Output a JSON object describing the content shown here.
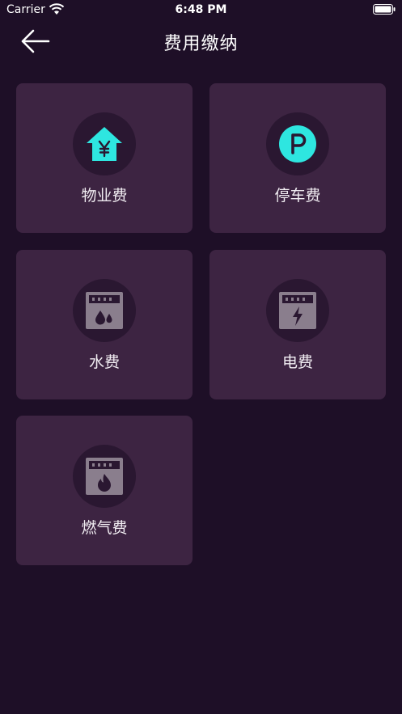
{
  "status": {
    "carrier": "Carrier",
    "time": "6:48 PM"
  },
  "nav": {
    "title": "费用缴纳"
  },
  "cards": [
    {
      "label": "物业费",
      "icon": "property-house-yen-icon"
    },
    {
      "label": "停车费",
      "icon": "parking-p-icon"
    },
    {
      "label": "水费",
      "icon": "water-meter-icon"
    },
    {
      "label": "电费",
      "icon": "electric-meter-icon"
    },
    {
      "label": "燃气费",
      "icon": "gas-meter-icon"
    }
  ],
  "colors": {
    "background": "#1e0f27",
    "card": "#3d2442",
    "accent": "#2ee6e0",
    "meter": "#8a7e8d"
  }
}
